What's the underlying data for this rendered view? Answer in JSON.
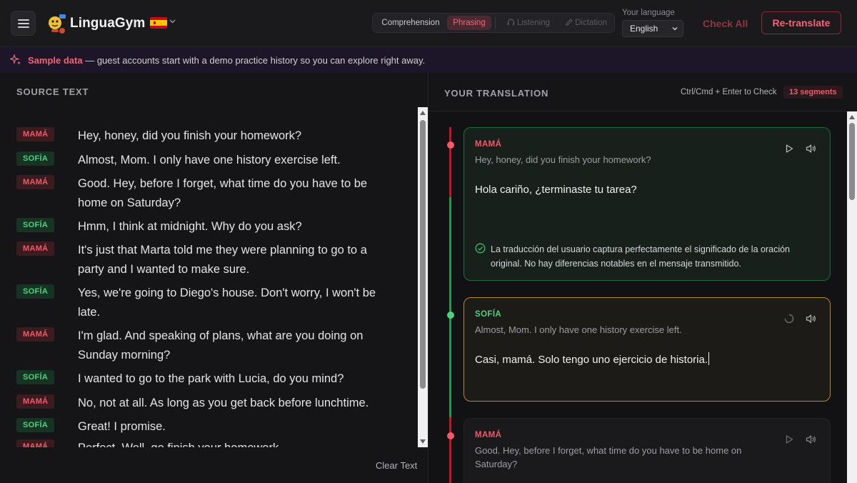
{
  "app": {
    "brand": "LinguaGym",
    "flag_name": "spain-flag"
  },
  "modes": [
    {
      "label": "Comprehension",
      "state": "normal"
    },
    {
      "label": "Phrasing",
      "state": "active"
    },
    {
      "label": "Listening",
      "state": "disabled",
      "icon": "headphones-icon"
    },
    {
      "label": "Dictation",
      "state": "disabled",
      "icon": "pencil-icon"
    }
  ],
  "language": {
    "label": "Your language",
    "selected": "English"
  },
  "actions": {
    "check_all": "Check All",
    "retranslate": "Re-translate"
  },
  "banner": {
    "strong": "Sample data",
    "text": " — guest accounts start with a demo practice history so you can explore right away."
  },
  "source": {
    "title": "SOURCE TEXT",
    "clear_label": "Clear Text",
    "rows": [
      {
        "speaker": "MAMÁ",
        "role": "mama",
        "text": "Hey, honey, did you finish your homework?"
      },
      {
        "speaker": "SOFÍA",
        "role": "sofia",
        "text": "Almost, Mom. I only have one history exercise left."
      },
      {
        "speaker": "MAMÁ",
        "role": "mama",
        "text": "Good. Hey, before I forget, what time do you have to be home on Saturday?"
      },
      {
        "speaker": "SOFÍA",
        "role": "sofia",
        "text": "Hmm, I think at midnight. Why do you ask?"
      },
      {
        "speaker": "MAMÁ",
        "role": "mama",
        "text": "It's just that Marta told me they were planning to go to a party and I wanted to make sure."
      },
      {
        "speaker": "SOFÍA",
        "role": "sofia",
        "text": "Yes, we're going to Diego's house. Don't worry, I won't be late."
      },
      {
        "speaker": "MAMÁ",
        "role": "mama",
        "text": "I'm glad. And speaking of plans, what are you doing on Sunday morning?"
      },
      {
        "speaker": "SOFÍA",
        "role": "sofia",
        "text": "I wanted to go to the park with Lucia, do you mind?"
      },
      {
        "speaker": "MAMÁ",
        "role": "mama",
        "text": "No, not at all. As long as you get back before lunchtime."
      },
      {
        "speaker": "SOFÍA",
        "role": "sofia",
        "text": "Great! I promise."
      },
      {
        "speaker": "MAMÁ",
        "role": "mama",
        "text": "Perfect. Well, go finish your homework."
      }
    ]
  },
  "translation": {
    "title": "YOUR TRANSLATION",
    "shortcut": "Ctrl/Cmd + Enter to Check",
    "segments_count": "13 segments",
    "cards": [
      {
        "speaker": "MAMÁ",
        "role": "mama",
        "status": "done",
        "source": "Hey, honey, did you finish your homework?",
        "translation": "Hola cariño, ¿terminaste tu tarea?",
        "feedback": "La traducción del usuario captura perfectamente el significado de la oración original. No hay diferencias notables en el mensaje transmitido."
      },
      {
        "speaker": "SOFÍA",
        "role": "sofia",
        "status": "active",
        "source": "Almost, Mom. I only have one history exercise left.",
        "translation": "Casi, mamá. Solo tengo uno ejercicio de historia."
      },
      {
        "speaker": "MAMÁ",
        "role": "mama",
        "status": "pending",
        "source": "Good. Hey, before I forget, what time do you have to be home on Saturday?",
        "translation": ""
      }
    ]
  },
  "colors": {
    "mama": "#f05a69",
    "sofia": "#4fd07f",
    "accent": "#f16677",
    "done_border": "#1f6a3d",
    "active_border": "#b68a1e"
  }
}
